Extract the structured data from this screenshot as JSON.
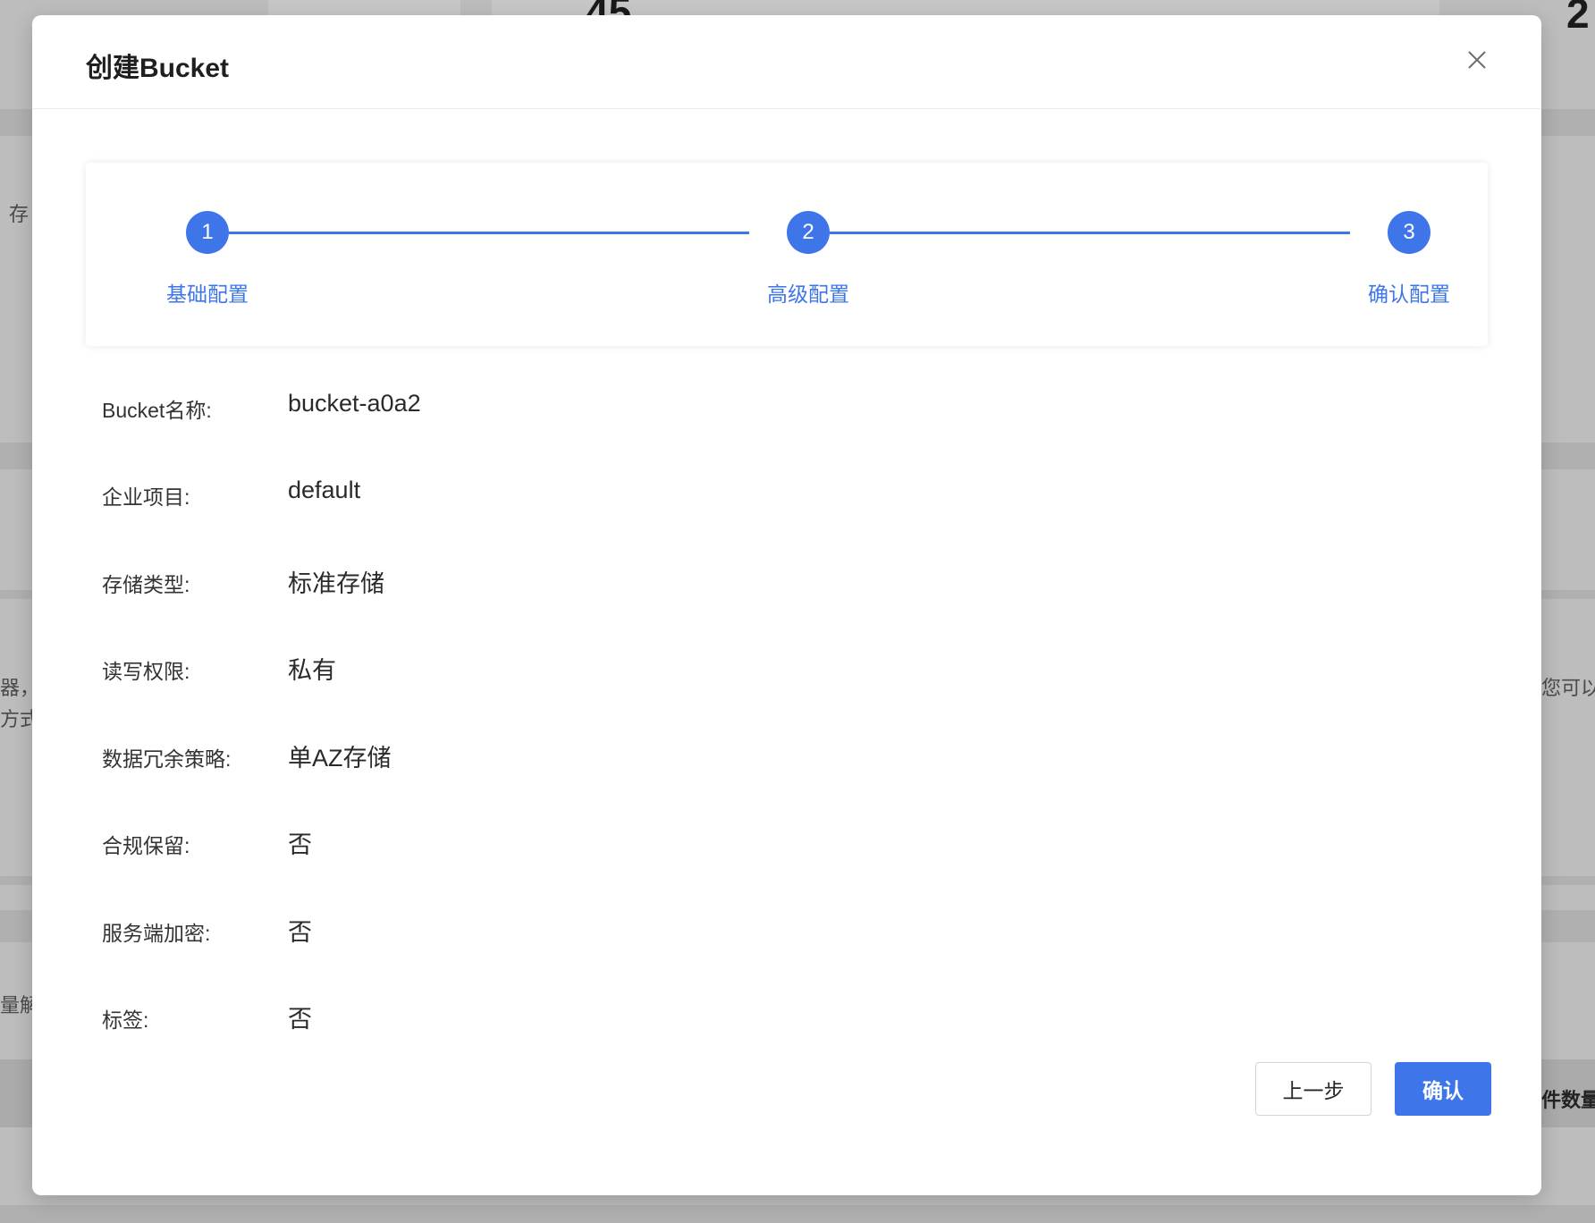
{
  "background": {
    "top_number": "45",
    "top_right_number": "2",
    "left_fragments": [
      "存",
      "器，",
      "方式",
      "量解"
    ],
    "right_fragments": [
      "您可以",
      "件数量"
    ]
  },
  "modal": {
    "title": "创建Bucket",
    "close_icon": "close-icon",
    "steps": [
      {
        "number": "1",
        "label": "基础配置"
      },
      {
        "number": "2",
        "label": "高级配置"
      },
      {
        "number": "3",
        "label": "确认配置"
      }
    ],
    "details": [
      {
        "label": "Bucket名称:",
        "value": "bucket-a0a2"
      },
      {
        "label": "企业项目:",
        "value": "default"
      },
      {
        "label": "存储类型:",
        "value": "标准存储"
      },
      {
        "label": "读写权限:",
        "value": "私有"
      },
      {
        "label": "数据冗余策略:",
        "value": "单AZ存储"
      },
      {
        "label": "合规保留:",
        "value": "否"
      },
      {
        "label": "服务端加密:",
        "value": "否"
      },
      {
        "label": "标签:",
        "value": "否"
      }
    ],
    "buttons": {
      "prev_label": "上一步",
      "confirm_label": "确认"
    }
  },
  "colors": {
    "accent": "#3e76ea",
    "overlay": "#bdbdbd"
  }
}
